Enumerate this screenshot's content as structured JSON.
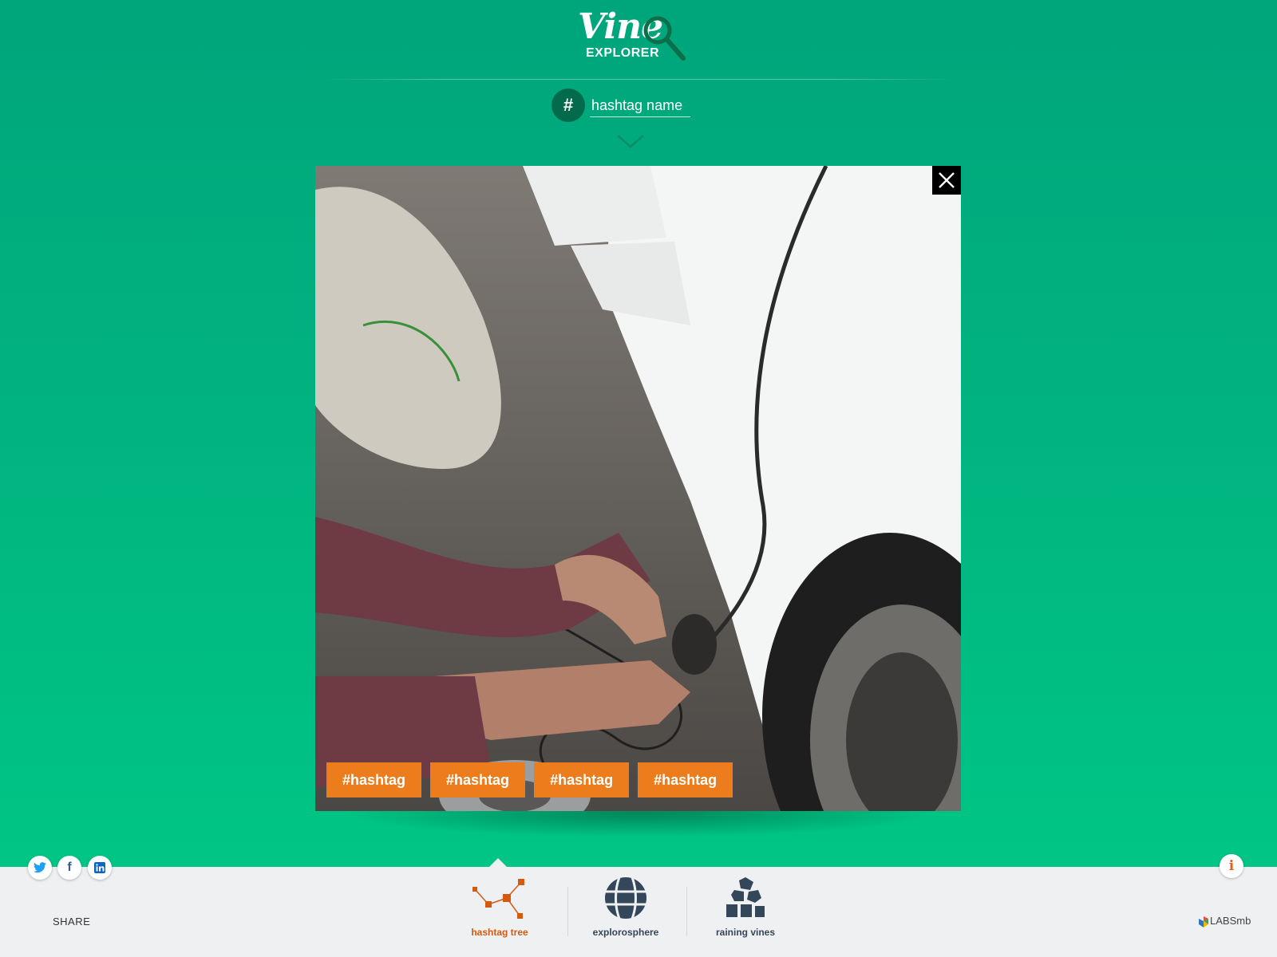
{
  "header": {
    "logo_word": "Vine",
    "logo_sub": "EXPLORER",
    "hash_symbol": "#",
    "search_placeholder": "hashtag name"
  },
  "modal": {
    "image_alt": "Person plugging a charging cable into a white electric car",
    "tags": [
      "#hashtag",
      "#hashtag",
      "#hashtag",
      "#hashtag"
    ]
  },
  "footer": {
    "share_label": "SHARE",
    "info_label": "i",
    "nav": [
      {
        "label": "hashtag tree",
        "active": true
      },
      {
        "label": "explorosphere",
        "active": false
      },
      {
        "label": "raining vines",
        "active": false
      }
    ],
    "brand": "LABSmb"
  },
  "colors": {
    "accent_orange": "#ed7d1c",
    "nav_active": "#d45a10",
    "nav_inactive": "#34465a",
    "background_green": "#01b47f",
    "hash_badge": "#036b4c"
  }
}
